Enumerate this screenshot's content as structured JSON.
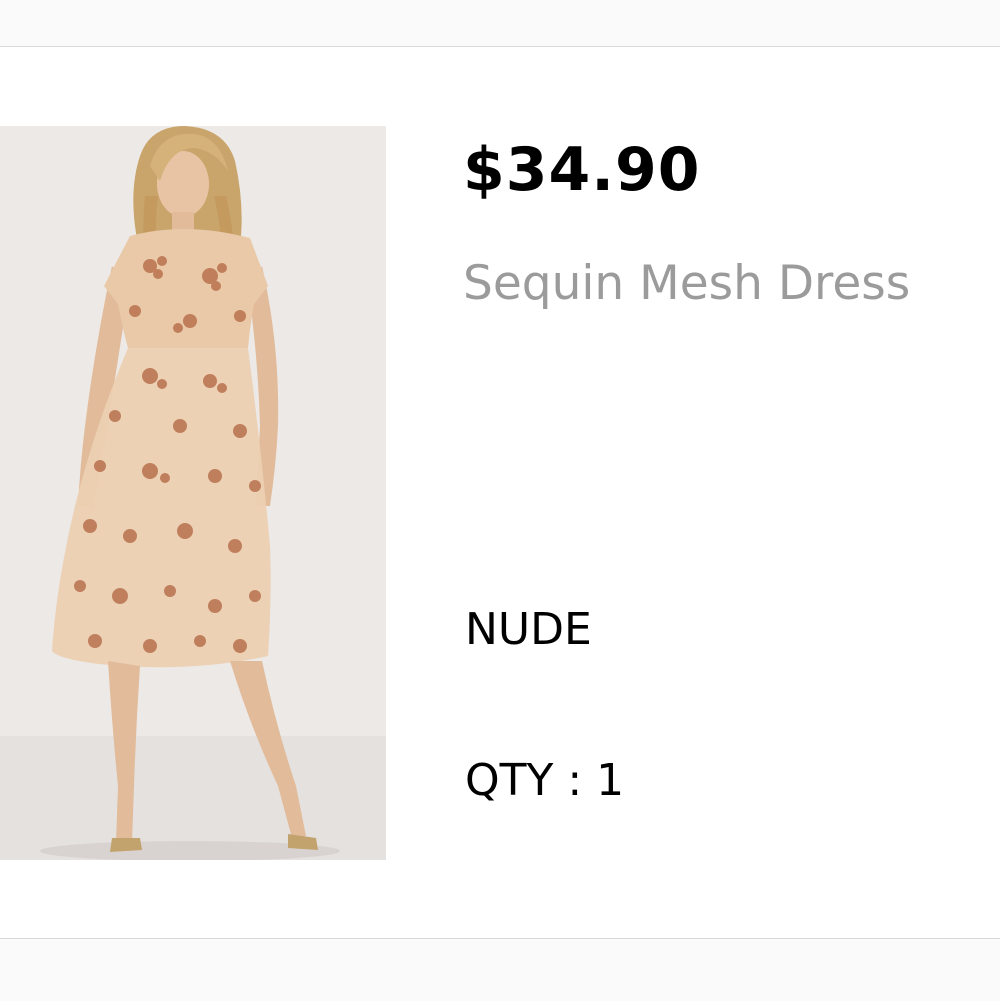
{
  "product": {
    "price": "$34.90",
    "name": "Sequin Mesh Dress",
    "color": "NUDE",
    "quantity": "QTY : 1"
  },
  "colors": {
    "price_text": "#000000",
    "name_text": "#9b9b9b",
    "divider": "#d9d9d9",
    "image_background": "#ece9e7",
    "dress": "#e9c9a8",
    "sequin": "#b9714d"
  }
}
